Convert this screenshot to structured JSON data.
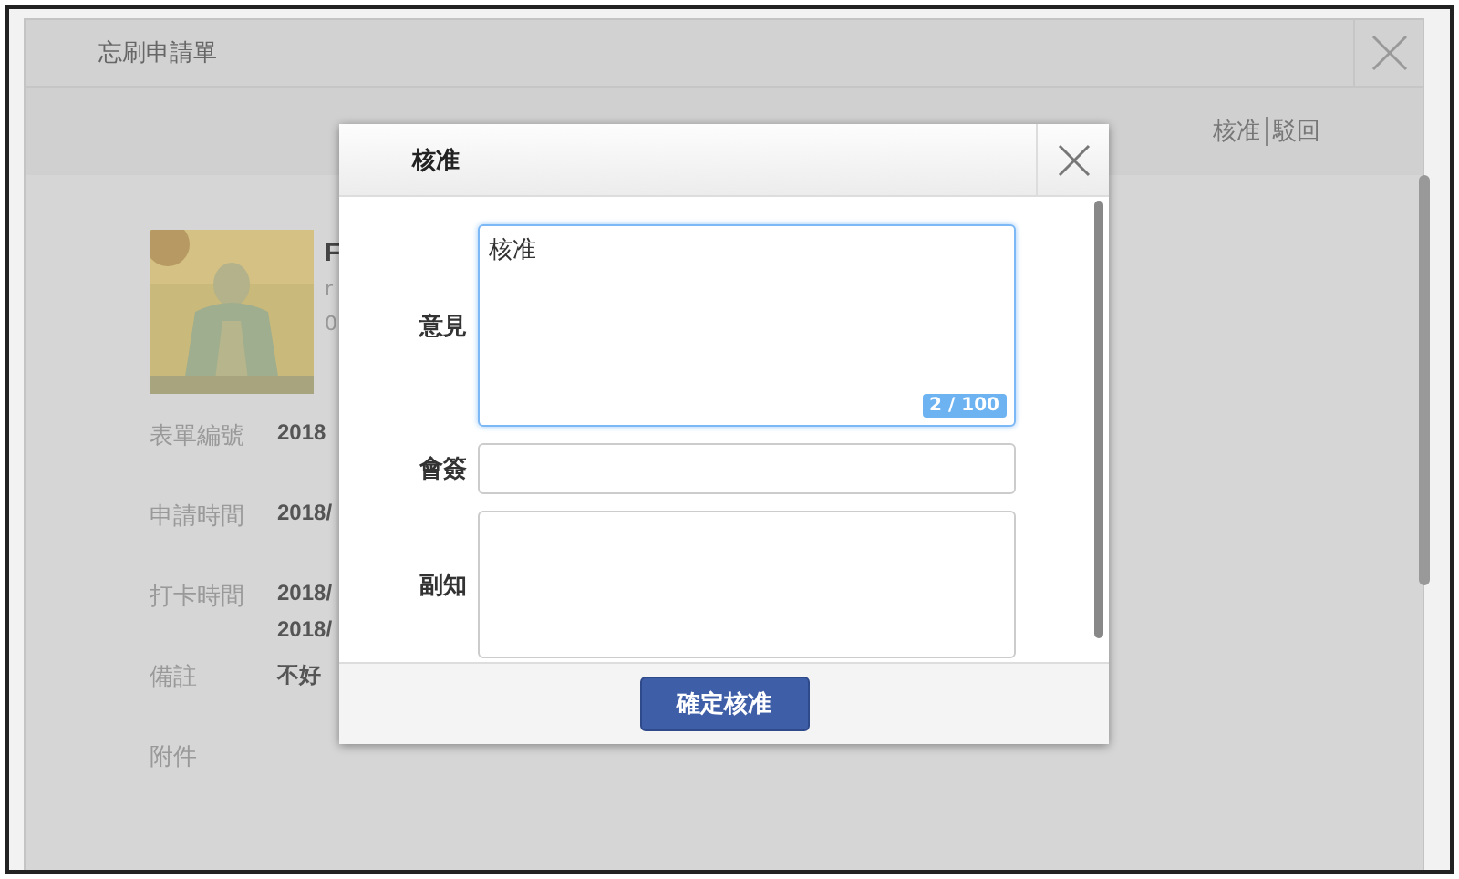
{
  "window": {
    "title": "忘刷申請單"
  },
  "actions": [
    {
      "label": "核准"
    },
    {
      "label": "駁回"
    }
  ],
  "profile": {
    "lines": [
      "F",
      "r",
      "0"
    ]
  },
  "fields": [
    {
      "label": "表單編號",
      "values": [
        "2018"
      ]
    },
    {
      "label": "申請時間",
      "values": [
        "2018/"
      ]
    },
    {
      "label": "打卡時間",
      "values": [
        "2018/",
        "2018/"
      ]
    },
    {
      "label": "備註",
      "values": [
        "不好"
      ]
    },
    {
      "label": "附件"
    }
  ],
  "dialog": {
    "title": "核准",
    "fields": [
      {
        "label": "意見",
        "kind": "textarea",
        "value": "核准",
        "counter": "2 / 100",
        "focused": true
      },
      {
        "label": "會簽",
        "kind": "input",
        "focused": false
      },
      {
        "label": "副知",
        "kind": "textarea",
        "focused": false
      }
    ],
    "submit": "確定核准"
  }
}
